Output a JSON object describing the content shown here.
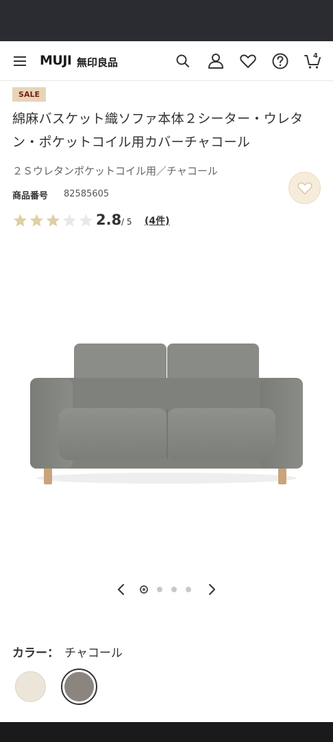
{
  "header": {
    "logo": "MUJI",
    "logo_sub": "無印良品",
    "cart_count": "4"
  },
  "product": {
    "badge": "SALE",
    "title": "綿麻バスケット織ソファ本体２シーター・ウレタン・ポケットコイル用カバーチャコール",
    "subtitle": "２Ｓウレタンポケットコイル用／チャコール",
    "product_number_label": "商品番号",
    "product_number": "82585605",
    "rating": {
      "value": "2.8",
      "max": "/ 5",
      "count": "(4件)",
      "filled_stars": 3,
      "total_stars": 5
    }
  },
  "carousel": {
    "total": 4,
    "active_index": 0
  },
  "color": {
    "label": "カラー：",
    "value": "チャコール",
    "swatches": [
      {
        "name": "natural",
        "hex": "#ece6da",
        "selected": false
      },
      {
        "name": "charcoal",
        "hex": "#8b8580",
        "selected": true
      }
    ]
  },
  "colors": {
    "sale_badge_bg": "#e5d5b5",
    "sale_badge_text": "#7b1c1c",
    "star_filled": "#e0cfa3",
    "star_empty": "#e8e8e8",
    "status_bar": "#2b2c31"
  }
}
